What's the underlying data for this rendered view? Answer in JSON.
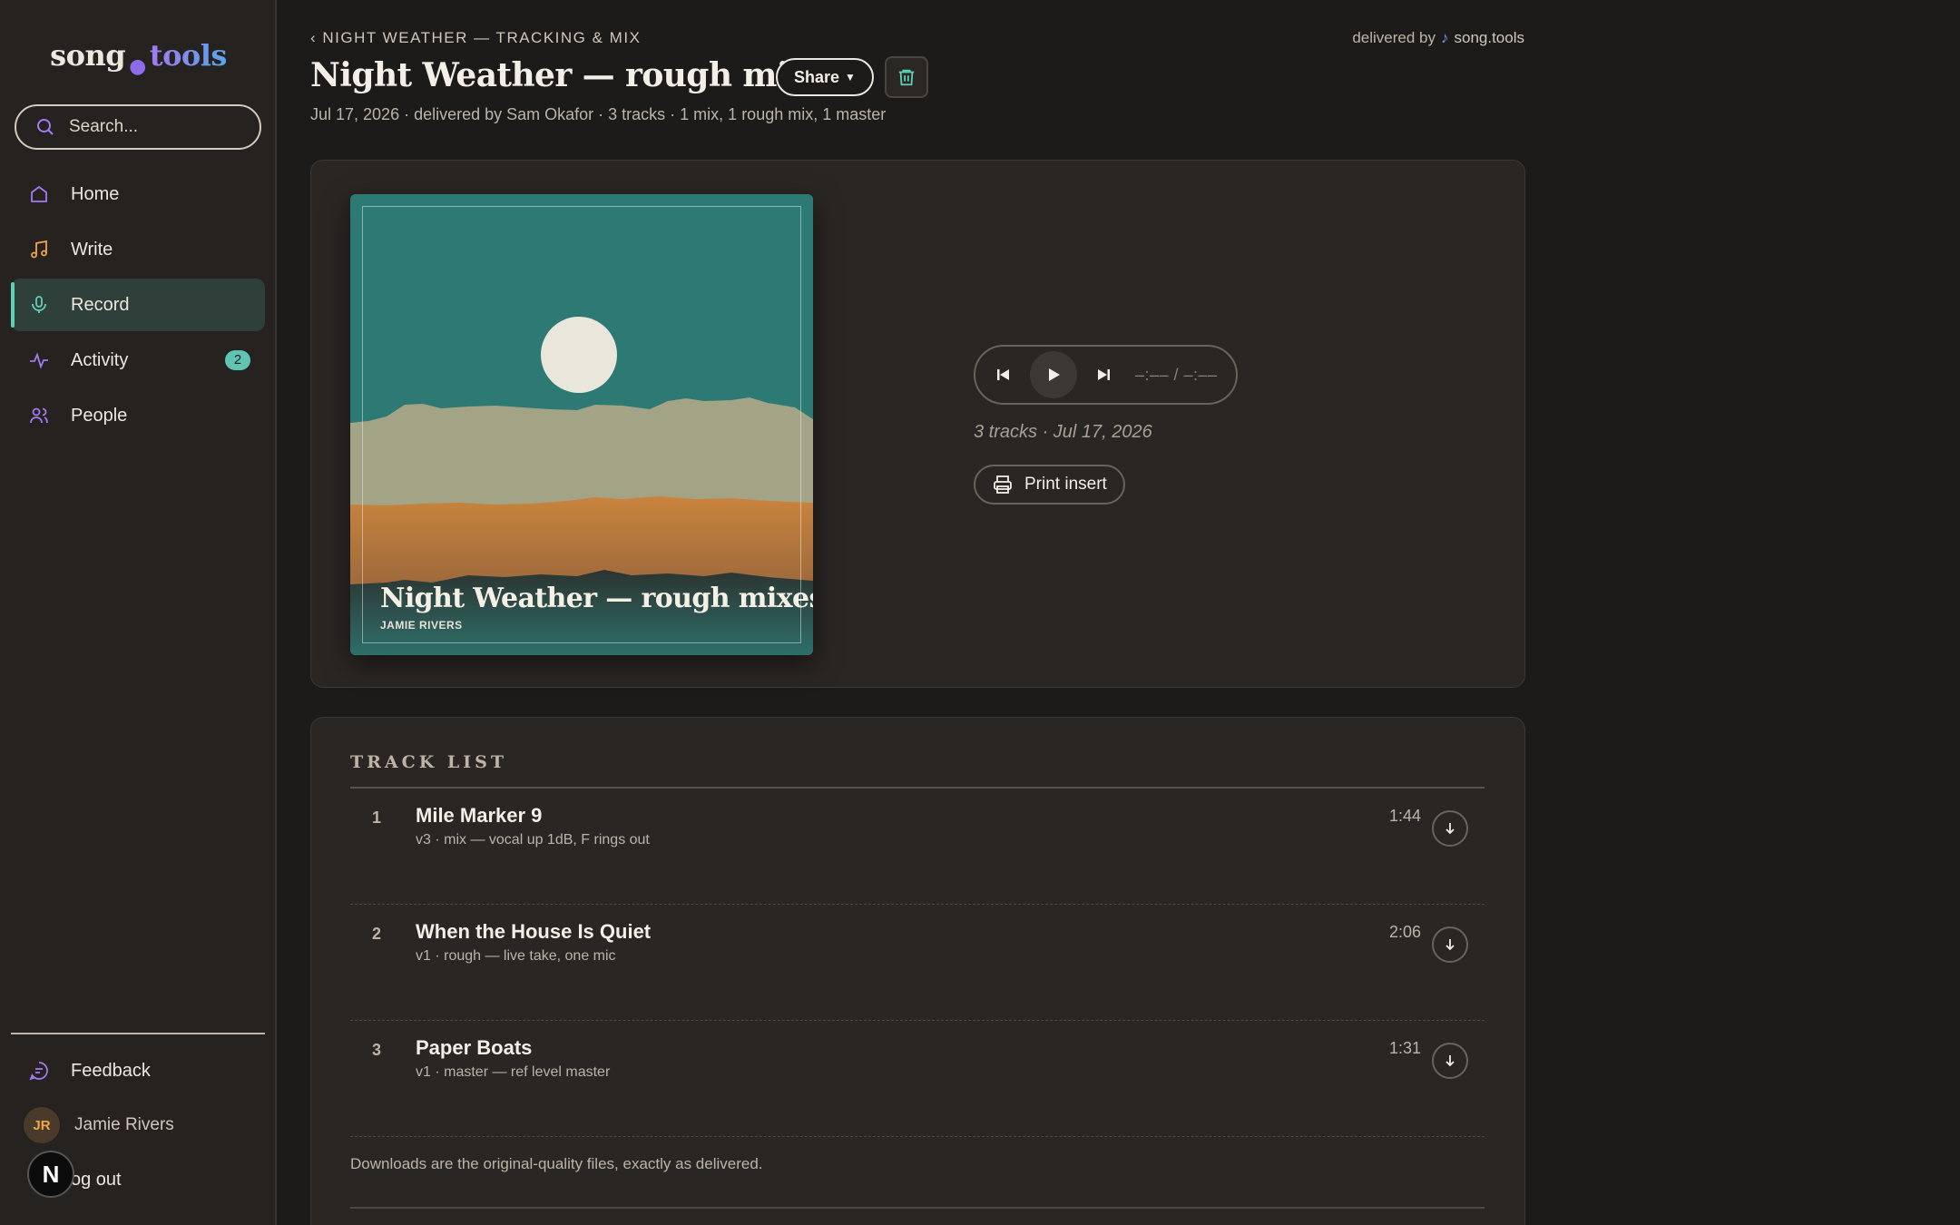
{
  "app": {
    "logo_song": "song",
    "logo_dot": ".",
    "logo_tools": "tools"
  },
  "sidebar": {
    "search_placeholder": "Search...",
    "items": [
      {
        "label": "Home",
        "icon": "home-icon"
      },
      {
        "label": "Write",
        "icon": "music-note-icon"
      },
      {
        "label": "Record",
        "icon": "microphone-icon",
        "active": true
      },
      {
        "label": "Activity",
        "icon": "activity-icon",
        "badge": "2"
      },
      {
        "label": "People",
        "icon": "people-icon"
      }
    ],
    "feedback_label": "Feedback",
    "user": {
      "initials": "JR",
      "name": "Jamie Rivers"
    },
    "logout_label": "og out",
    "n_badge": "N"
  },
  "header": {
    "breadcrumb": "‹ NIGHT WEATHER — TRACKING & MIX",
    "delivered_by_label": "delivered by",
    "delivered_by_brand": "song.tools",
    "title": "Night Weather — rough mixes",
    "share_label": "Share",
    "meta": "Jul 17, 2026 · delivered by Sam Okafor · 3 tracks · 1 mix, 1 rough mix, 1 master"
  },
  "cover": {
    "title": "Night Weather — rough mixes",
    "artist": "JAMIE RIVERS"
  },
  "player": {
    "time": "–:–– / –:––",
    "summary": "3 tracks · Jul 17, 2026",
    "print_label": "Print insert"
  },
  "tracklist": {
    "header": "TRACK LIST",
    "tracks": [
      {
        "num": "1",
        "name": "Mile Marker 9",
        "sub": "v3 · mix — vocal up 1dB, F rings out",
        "duration": "1:44"
      },
      {
        "num": "2",
        "name": "When the House Is Quiet",
        "sub": "v1 · rough — live take, one mic",
        "duration": "2:06"
      },
      {
        "num": "3",
        "name": "Paper Boats",
        "sub": "v1 · master — ref level master",
        "duration": "1:31"
      }
    ],
    "footnote": "Downloads are the original-quality files, exactly as delivered."
  },
  "colors": {
    "accent": "#5fd0b8",
    "brand_purple": "#8e6be8",
    "background": "#1d1b1a"
  }
}
